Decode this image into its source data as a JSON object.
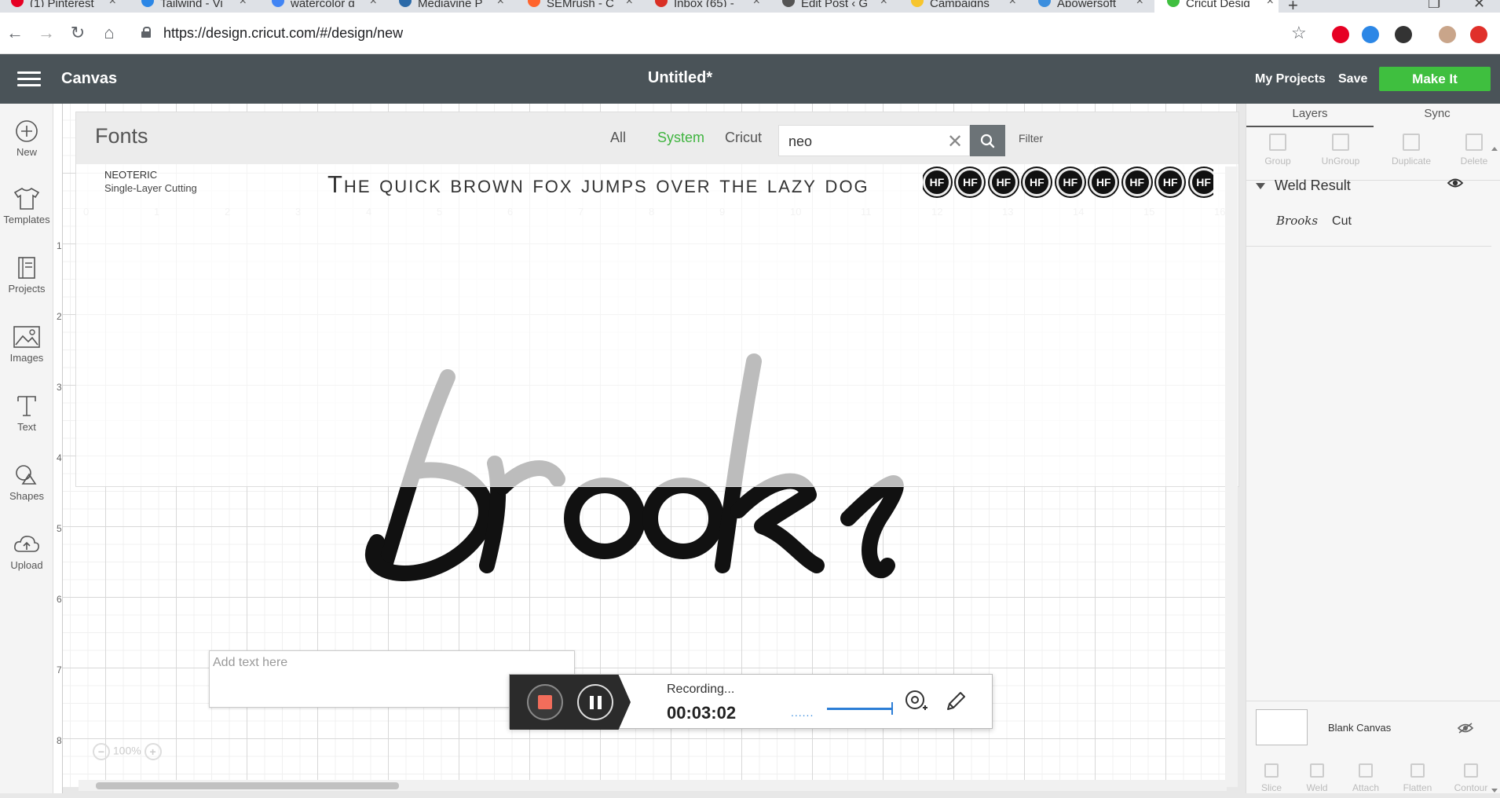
{
  "browser": {
    "tabs": [
      {
        "label": "(1) Pinterest",
        "color": "#e60023"
      },
      {
        "label": "Tailwind - Vi",
        "color": "#2c87e6"
      },
      {
        "label": "watercolor g",
        "color": "#4285f4"
      },
      {
        "label": "Mediavine P",
        "color": "#2b6aa8"
      },
      {
        "label": "SEMrush - C",
        "color": "#ff642d"
      },
      {
        "label": "Inbox (65) -",
        "color": "#d93025"
      },
      {
        "label": "Edit Post ‹ G",
        "color": "#555555"
      },
      {
        "label": "Campaigns",
        "color": "#f7c52d"
      },
      {
        "label": "Apowersoft",
        "color": "#3b8ede"
      },
      {
        "label": "Cricut Desig",
        "color": "#3fbf3f"
      }
    ],
    "new_tab": "+",
    "url": "https://design.cricut.com/#/design/new"
  },
  "header": {
    "brand": "Canvas",
    "title": "Untitled*",
    "my_projects": "My Projects",
    "save": "Save",
    "make_it": "Make It",
    "accent": "#3fbf3f"
  },
  "sidebar": {
    "items": [
      {
        "label": "New",
        "icon": "plus-circle-icon"
      },
      {
        "label": "Templates",
        "icon": "tshirt-icon"
      },
      {
        "label": "Projects",
        "icon": "book-icon"
      },
      {
        "label": "Images",
        "icon": "image-icon"
      },
      {
        "label": "Text",
        "icon": "text-icon"
      },
      {
        "label": "Shapes",
        "icon": "shapes-icon"
      },
      {
        "label": "Upload",
        "icon": "cloud-upload-icon"
      }
    ]
  },
  "ruler": {
    "left": [
      "1",
      "2",
      "3",
      "4",
      "5",
      "6",
      "7",
      "8"
    ],
    "top": [
      "0",
      "1",
      "2",
      "3",
      "4",
      "5",
      "6",
      "7",
      "8",
      "9",
      "10",
      "11",
      "12",
      "13",
      "14",
      "15",
      "16"
    ]
  },
  "fonts_panel": {
    "title": "Fonts",
    "tabs": [
      "All",
      "System",
      "Cricut"
    ],
    "selected_tab": "System",
    "search_value": "neo",
    "filter": "Filter",
    "font_name": "NEOTERIC",
    "font_subtitle": "Single-Layer Cutting",
    "sample": "The quick brown fox jumps over the lazy dog",
    "glyph_label": "HF"
  },
  "canvas": {
    "text_box_placeholder": "Add text here",
    "zoom": "100%",
    "artwork_word": "Brooks"
  },
  "recorder": {
    "status": "Recording...",
    "elapsed": "00:03:02",
    "stop_color": "#f26d5b"
  },
  "right_panel": {
    "tabs": [
      "Layers",
      "Sync"
    ],
    "selected_tab": "Layers",
    "top_actions": [
      "Group",
      "UnGroup",
      "Duplicate",
      "Delete"
    ],
    "group_name": "Weld Result",
    "layer_label": "Cut",
    "blank_canvas": "Blank Canvas",
    "bottom_actions": [
      "Slice",
      "Weld",
      "Attach",
      "Flatten",
      "Contour"
    ]
  }
}
